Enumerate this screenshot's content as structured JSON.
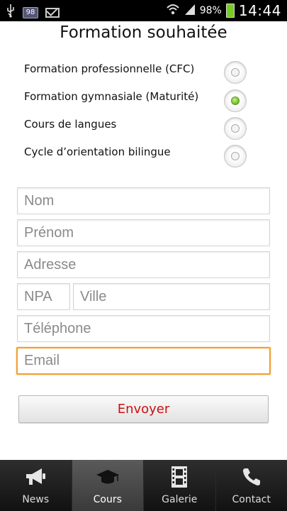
{
  "status_bar": {
    "badge": "98",
    "battery_percent": "98%",
    "time": "14:44"
  },
  "form": {
    "title": "Formation souhaitée",
    "options": [
      {
        "label": "Formation professionnelle (CFC)",
        "checked": false
      },
      {
        "label": "Formation gymnasiale (Maturité)",
        "checked": true
      },
      {
        "label": "Cours de langues",
        "checked": false
      },
      {
        "label": "Cycle d’orientation bilingue",
        "checked": false
      }
    ],
    "fields": {
      "nom": {
        "placeholder": "Nom",
        "value": ""
      },
      "prenom": {
        "placeholder": "Prénom",
        "value": ""
      },
      "adresse": {
        "placeholder": "Adresse",
        "value": ""
      },
      "npa": {
        "placeholder": "NPA",
        "value": ""
      },
      "ville": {
        "placeholder": "Ville",
        "value": ""
      },
      "telephone": {
        "placeholder": "Téléphone",
        "value": ""
      },
      "email": {
        "placeholder": "Email",
        "value": ""
      }
    },
    "submit_label": "Envoyer"
  },
  "tabs": [
    {
      "label": "News",
      "icon": "megaphone-icon",
      "active": false
    },
    {
      "label": "Cours",
      "icon": "graduation-cap-icon",
      "active": true
    },
    {
      "label": "Galerie",
      "icon": "film-icon",
      "active": false
    },
    {
      "label": "Contact",
      "icon": "phone-icon",
      "active": false
    }
  ],
  "colors": {
    "accent_focus": "#f0a030",
    "submit_text": "#cc1010",
    "radio_checked": "#7cc534"
  }
}
